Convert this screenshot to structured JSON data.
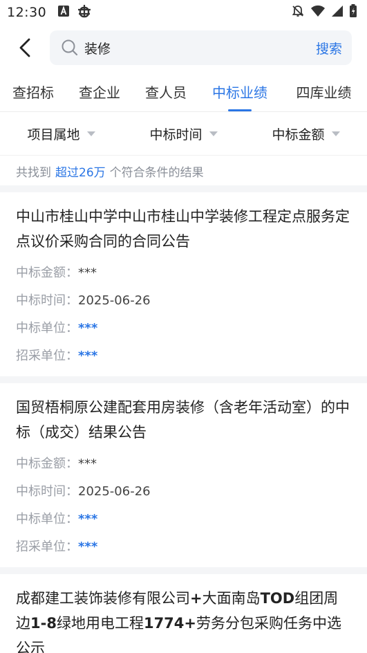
{
  "status_bar": {
    "time": "12:30"
  },
  "search": {
    "value": "装修",
    "submit_label": "搜索"
  },
  "tabs": [
    {
      "label": "查招标",
      "active": false
    },
    {
      "label": "查企业",
      "active": false
    },
    {
      "label": "查人员",
      "active": false
    },
    {
      "label": "中标业绩",
      "active": true
    },
    {
      "label": "四库业绩",
      "active": false
    }
  ],
  "filters": [
    {
      "label": "项目属地"
    },
    {
      "label": "中标时间"
    },
    {
      "label": "中标金额"
    }
  ],
  "result_summary": {
    "prefix": "共找到",
    "count": "超过26万",
    "suffix": "个符合条件的结果"
  },
  "field_labels": {
    "amount": "中标金额：",
    "time": "中标时间：",
    "winner": "中标单位：",
    "buyer": "招采单位："
  },
  "results": [
    {
      "title": "中山市桂山中学中山市桂山中学装修工程定点服务定点议价采购合同的合同公告",
      "amount": "***",
      "time": "2025-06-26",
      "winner": "***",
      "buyer": "***"
    },
    {
      "title": "国贸梧桐原公建配套用房装修（含老年活动室）的中标（成交）结果公告",
      "amount": "***",
      "time": "2025-06-26",
      "winner": "***",
      "buyer": "***"
    },
    {
      "title_parts": [
        "成都建工装饰装修有限公司",
        "+",
        "大面南岛",
        "TOD",
        "组团周边",
        "1-8",
        "绿地用电工程",
        "1774+",
        "劳务分包采购任务中选公示"
      ]
    }
  ],
  "colors": {
    "accent": "#2b76e5",
    "label_gray": "#9a9ea6",
    "divider": "#f4f5f7"
  }
}
